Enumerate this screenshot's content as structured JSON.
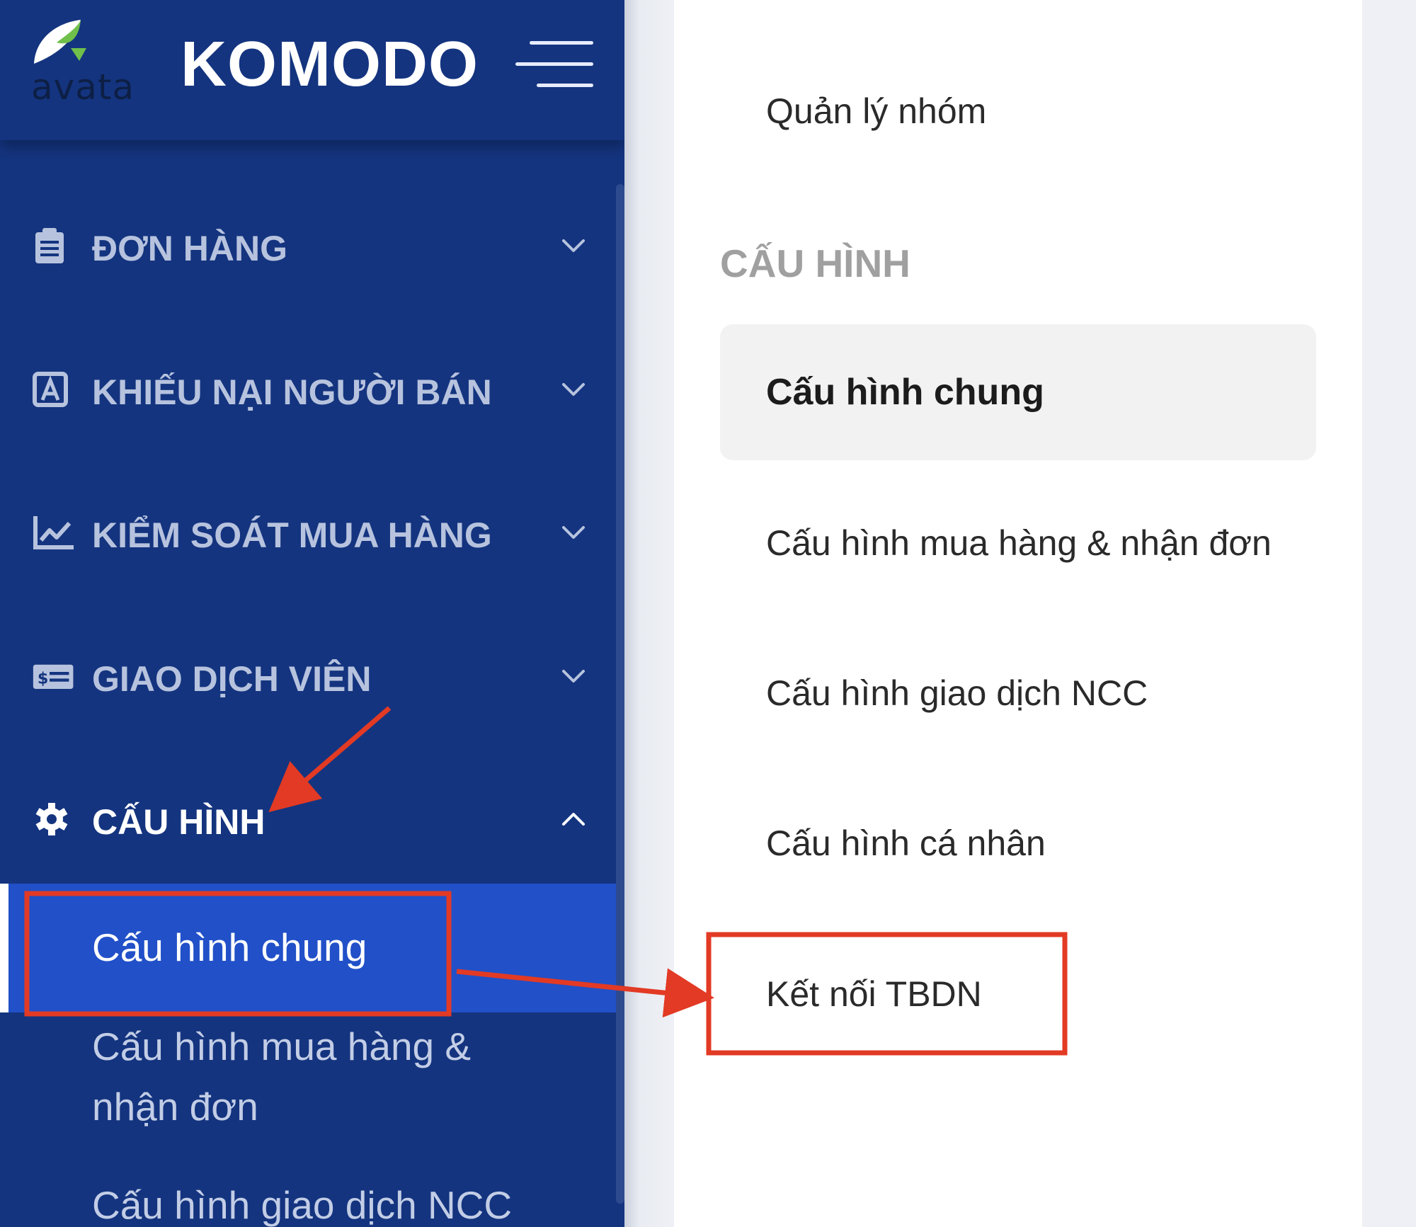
{
  "sidebar": {
    "logo_text": "avata",
    "brand": "KOMODO",
    "menu": [
      {
        "label": "ĐƠN HÀNG",
        "icon": "clipboard-icon",
        "expanded": false
      },
      {
        "label": "KHIẾU NẠI NGƯỜI BÁN",
        "icon": "complaint-icon",
        "expanded": false
      },
      {
        "label": "KIỂM SOÁT MUA HÀNG",
        "icon": "chart-line-icon",
        "expanded": false
      },
      {
        "label": "GIAO DỊCH VIÊN",
        "icon": "money-card-icon",
        "expanded": false
      },
      {
        "label": "CẤU HÌNH",
        "icon": "gear-icon",
        "expanded": true
      }
    ],
    "submenu": {
      "current": "Cấu hình chung",
      "purchase_line1": "Cấu hình mua hàng &",
      "purchase_line2": "nhận đơn",
      "supplier": "Cấu hình giao dịch NCC"
    }
  },
  "panel": {
    "group_mgmt": "Quản lý nhóm",
    "section_title": "CẤU HÌNH",
    "items": [
      "Cấu hình chung",
      "Cấu hình mua hàng & nhận đơn",
      "Cấu hình giao dịch NCC",
      "Cấu hình cá nhân",
      "Kết nối TBDN"
    ]
  },
  "colors": {
    "sidebar_bg": "#14347f",
    "sidebar_active": "#2150c8",
    "annotation_red": "#e23a24"
  }
}
